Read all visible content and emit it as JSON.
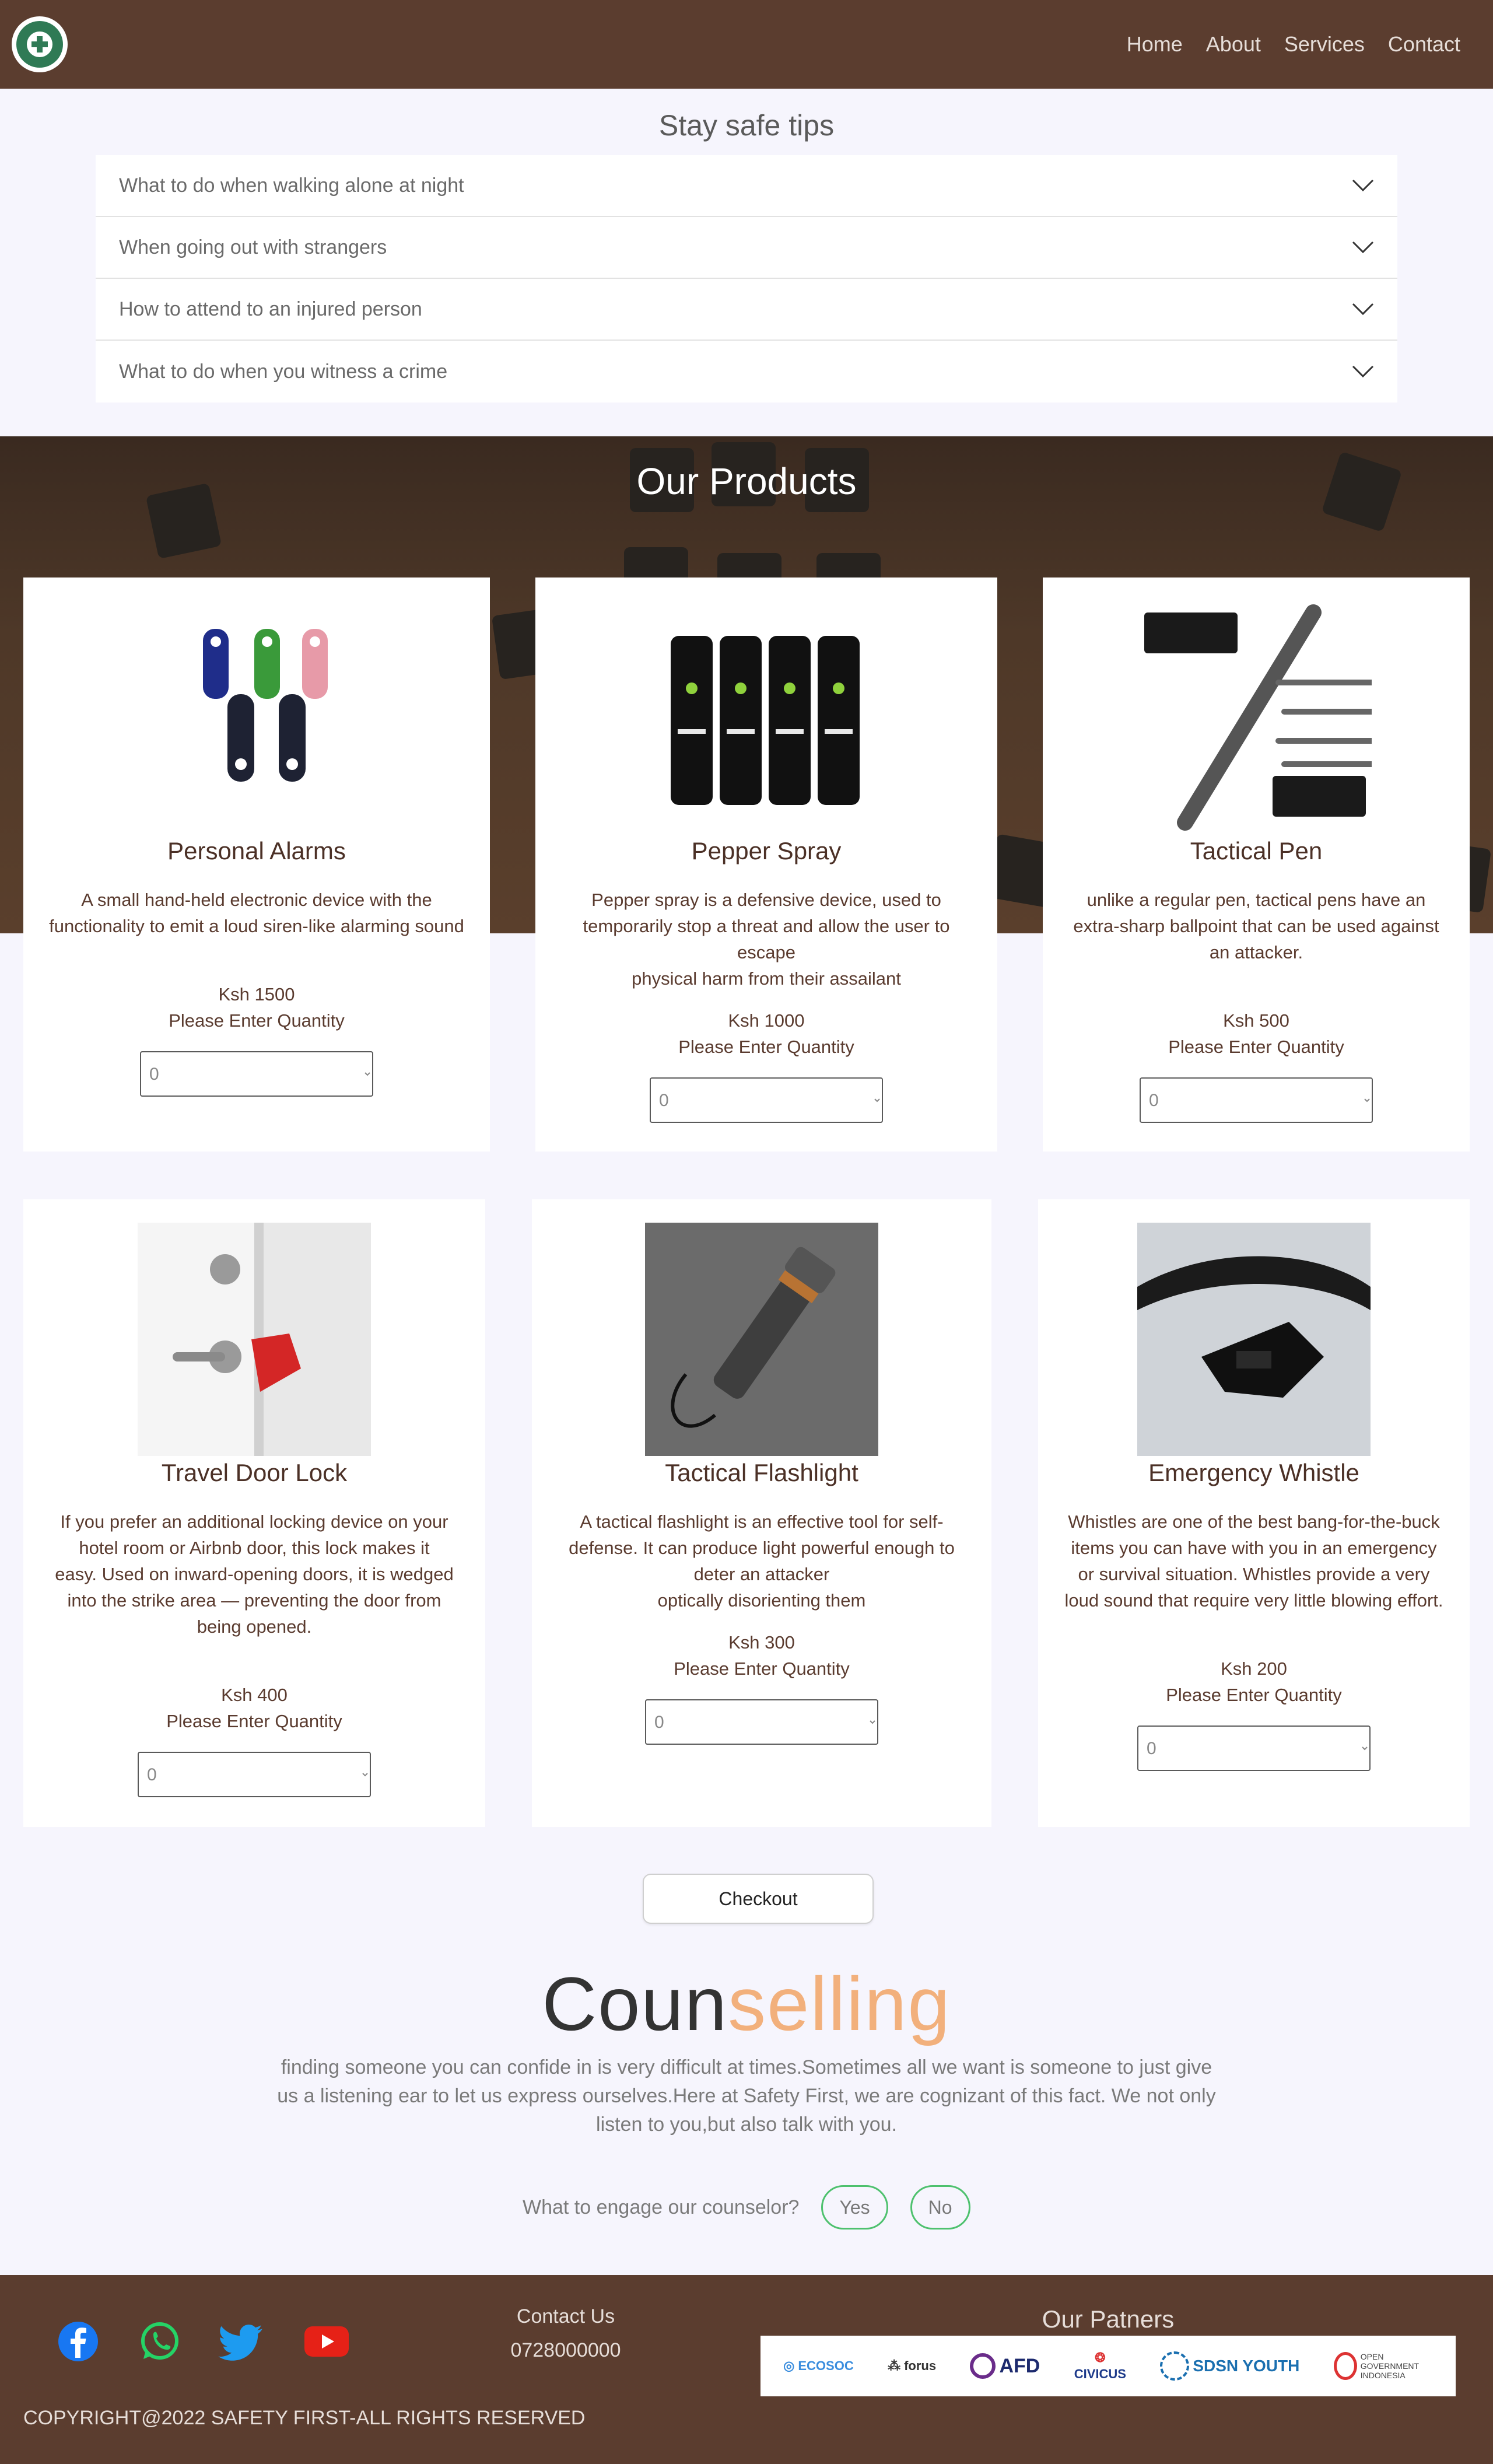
{
  "nav": {
    "links": [
      "Home",
      "About",
      "Services",
      "Contact"
    ]
  },
  "tips": {
    "title": "Stay safe tips",
    "items": [
      "What to do when walking alone at night",
      "When going out with strangers",
      "How to attend to an injured person",
      "What to do when you witness a crime"
    ]
  },
  "products": {
    "title": "Our Products",
    "items": [
      {
        "name": "Personal Alarms",
        "desc": "A small hand-held electronic device with the functionality to emit a loud siren-like alarming sound",
        "price": "Ksh 1500",
        "qty_label": "Please Enter Quantity",
        "qty_value": "0"
      },
      {
        "name": "Pepper Spray",
        "desc": "Pepper spray is a defensive device, used to temporarily stop a threat and allow the user to escape\nphysical harm from their assailant",
        "price": "Ksh 1000",
        "qty_label": "Please Enter Quantity",
        "qty_value": "0"
      },
      {
        "name": "Tactical Pen",
        "desc": "unlike a regular pen, tactical pens have an extra-sharp ballpoint that can be used against\nan attacker.",
        "price": "Ksh 500",
        "qty_label": "Please Enter Quantity",
        "qty_value": "0"
      },
      {
        "name": "Travel Door Lock",
        "desc": "If you prefer an additional locking device on your hotel room or Airbnb door, this lock makes it\neasy. Used on inward-opening doors, it is wedged into the strike area — preventing the door from being opened.",
        "price": "Ksh 400",
        "qty_label": "Please Enter Quantity",
        "qty_value": "0"
      },
      {
        "name": "Tactical Flashlight",
        "desc": "A tactical flashlight is an effective tool for self-defense. It can produce light powerful enough to deter an attacker\noptically disorienting them",
        "price": "Ksh 300",
        "qty_label": "Please Enter Quantity",
        "qty_value": "0"
      },
      {
        "name": "Emergency Whistle",
        "desc": "Whistles are one of the best bang-for-the-buck items you can have with you in an emergency or survival situation. Whistles provide a very loud sound that require very little blowing effort.",
        "price": "Ksh 200",
        "qty_label": "Please Enter Quantity",
        "qty_value": "0"
      }
    ]
  },
  "checkout": {
    "label": "Checkout"
  },
  "counselling": {
    "title_a": "Coun",
    "title_b": "selling",
    "text": "finding someone you can confide in is very difficult at times.Sometimes all we want is someone to just give us a listening ear to let us express ourselves.Here at Safety First, we are cognizant of this fact. We not only listen to you,but also talk with you.",
    "engage_label": "What to engage our counselor?",
    "yes": "Yes",
    "no": "No"
  },
  "footer": {
    "contact_title": "Contact Us",
    "phone": "0728000000",
    "partners_title": "Our Patners",
    "partners": [
      "ECOSOC",
      "forus",
      "AFD",
      "CIVICUS",
      "SDSN YOUTH",
      "OPEN GOVERNMENT INDONESIA"
    ],
    "copyright": "COPYRIGHT@2022 SAFETY FIRST-ALL RIGHTS RESERVED"
  },
  "colors": {
    "brand_brown": "#5b3d2f",
    "accent_orange": "#f2b07c",
    "accent_green": "#4ec16e",
    "facebook": "#1877f2",
    "whatsapp": "#25d366",
    "twitter": "#1d9bf0",
    "youtube": "#e62117"
  },
  "icons": [
    "facebook-icon",
    "whatsapp-icon",
    "twitter-icon",
    "youtube-icon",
    "chevron-down-icon"
  ]
}
